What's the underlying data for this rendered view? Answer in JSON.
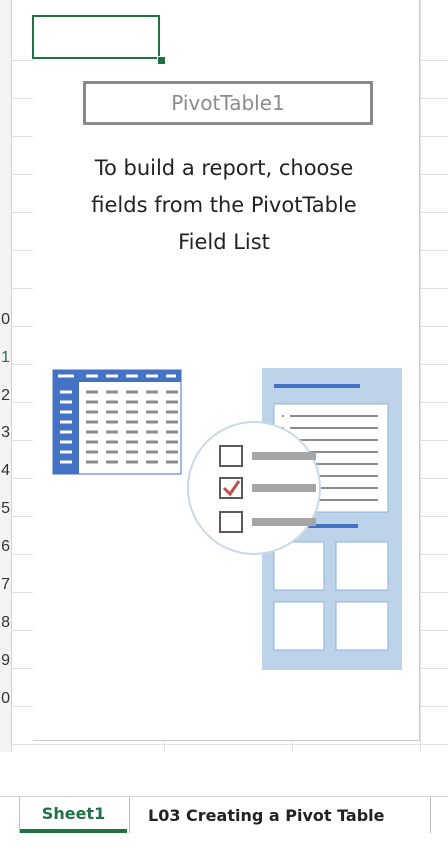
{
  "pivot": {
    "name": "PivotTable1",
    "instruction_lines": [
      "To build a report, choose",
      "fields from the PivotTable",
      "Field List"
    ]
  },
  "row_headers": [
    "0",
    "1",
    "2",
    "3",
    "4",
    "5",
    "6",
    "7",
    "8",
    "9",
    "0"
  ],
  "selected_row_index": 1,
  "sheet_tabs": [
    {
      "label": "Sheet1",
      "active": true
    },
    {
      "label": "L03 Creating a Pivot Table",
      "active": false
    }
  ],
  "colors": {
    "accent": "#217346",
    "illustration_blue": "#4472c4",
    "illustration_light": "#bcd3ea",
    "check_red": "#c0504d"
  }
}
